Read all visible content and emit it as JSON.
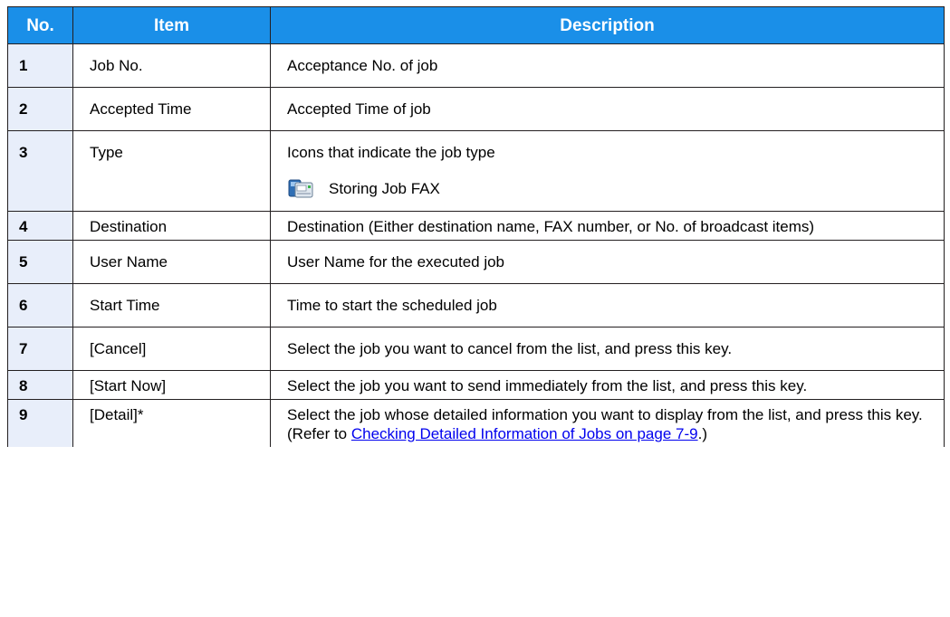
{
  "table": {
    "headers": {
      "no": "No.",
      "item": "Item",
      "description": "Description"
    },
    "rows": [
      {
        "no": "1",
        "item": "Job No.",
        "description": "Acceptance No. of job"
      },
      {
        "no": "2",
        "item": "Accepted Time",
        "description": "Accepted Time of job"
      },
      {
        "no": "3",
        "item": "Type",
        "description": "Icons that indicate the job type",
        "icon_label": "Storing Job FAX",
        "icon_name": "fax-job-icon"
      },
      {
        "no": "4",
        "item": "Destination",
        "description": "Destination (Either destination name, FAX number, or No. of broadcast items)"
      },
      {
        "no": "5",
        "item": "User Name",
        "description": "User Name for the executed job"
      },
      {
        "no": "6",
        "item": "Start Time",
        "description": "Time to start the scheduled job"
      },
      {
        "no": "7",
        "item": "[Cancel]",
        "description": "Select the job you want to cancel from the list, and press this key."
      },
      {
        "no": "8",
        "item": "[Start Now]",
        "description": "Select the job you want to send immediately from the list, and press this key."
      },
      {
        "no": "9",
        "item": "[Detail]*",
        "description_prefix": "Select the job whose detailed information you want to display from the list, and press this key. (Refer to ",
        "link_text": "Checking Detailed Information of Jobs on page 7-9",
        "description_suffix": ".)"
      }
    ]
  },
  "colors": {
    "header_bg": "#1a8fe8",
    "number_cell_bg": "#e8eefa",
    "link": "#0000ee"
  }
}
